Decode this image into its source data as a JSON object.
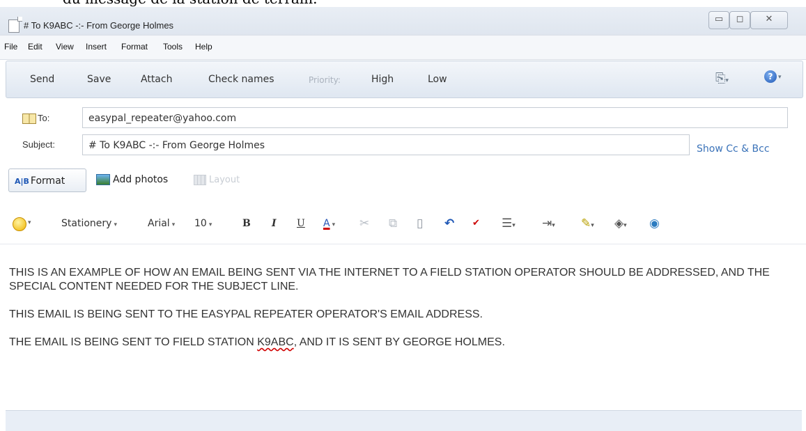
{
  "stray_text": "du message de la station de terrain.",
  "window": {
    "title": "# To K9ABC -:- From George Holmes",
    "controls": {
      "minimize": "▭",
      "maximize": "◻",
      "close": "✕"
    }
  },
  "menu": [
    "File",
    "Edit",
    "View",
    "Insert",
    "Format",
    "Tools",
    "Help"
  ],
  "toolbar": {
    "send": "Send",
    "save": "Save",
    "attach": "Attach",
    "check_names": "Check names",
    "priority_label": "Priority:",
    "high": "High",
    "low": "Low",
    "icons": [
      "send-receive-icon",
      "help-icon"
    ]
  },
  "header": {
    "to_label": "To:",
    "to_value": "easypal_repeater@yahoo.com",
    "subject_label": "Subject:",
    "subject_value": "# To K9ABC -:- From George Holmes",
    "show_cc_bcc": "Show Cc & Bcc",
    "format_button": "Format",
    "add_photos": "Add photos",
    "layout": "Layout"
  },
  "format_bar": {
    "stationery": "Stationery",
    "font": "Arial",
    "size": "10",
    "bold": "B",
    "italic": "I",
    "underline": "U",
    "font_color": "A",
    "icons": [
      "emoticon-icon",
      "cut-icon",
      "copy-icon",
      "paste-icon",
      "undo-icon",
      "spellcheck-icon",
      "bullet-list-icon",
      "indent-icon",
      "highlight-icon",
      "fill-color-icon",
      "web-icon"
    ]
  },
  "body": {
    "paragraph1": "THIS IS AN EXAMPLE OF HOW AN EMAIL BEING SENT VIA THE INTERNET TO A FIELD STATION OPERATOR SHOULD BE ADDRESSED, AND THE SPECIAL CONTENT NEEDED FOR THE SUBJECT LINE.",
    "paragraph2": "THIS EMAIL IS BEING SENT TO THE EASYPAL REPEATER OPERATOR'S EMAIL ADDRESS.",
    "paragraph3_before": "THE EMAIL IS BEING SENT TO FIELD STATION ",
    "paragraph3_callsign": "K9ABC",
    "paragraph3_after": ", AND IT IS SENT BY GEORGE HOLMES."
  },
  "colors": {
    "accent": "#3b73b9",
    "font_color_underline": "#d00000",
    "toolbar_bg": "#e6edf5"
  }
}
